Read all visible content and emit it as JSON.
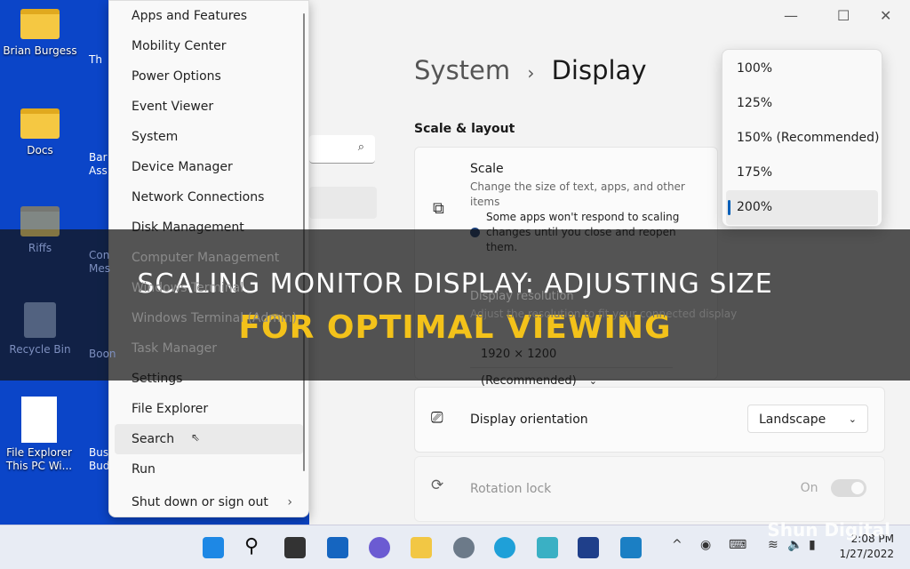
{
  "desktop": {
    "icons": [
      {
        "label": "Brian Burgess"
      },
      {
        "label": "Docs"
      },
      {
        "label": "Riffs"
      },
      {
        "label": "Recycle Bin"
      },
      {
        "label": "File Explorer This PC Wi..."
      }
    ],
    "partial_icons": [
      {
        "label": "Th"
      },
      {
        "label": "Bar Ass"
      },
      {
        "label": "Con Mes"
      },
      {
        "label": "Boon"
      },
      {
        "label": "Busin Bud"
      }
    ]
  },
  "context_menu": {
    "items": [
      "Apps and Features",
      "Mobility Center",
      "Power Options",
      "Event Viewer",
      "System",
      "Device Manager",
      "Network Connections",
      "Disk Management",
      "Computer Management",
      "Windows Terminal",
      "Windows Terminal (Admin)",
      "Task Manager",
      "Settings",
      "File Explorer",
      "Search",
      "Run",
      "Shut down or sign out"
    ],
    "hovered": "Search"
  },
  "settings": {
    "breadcrumb_parent": "System",
    "breadcrumb_sep": "›",
    "breadcrumb_current": "Display",
    "section": "Scale & layout",
    "scale": {
      "title": "Scale",
      "desc": "Change the size of text, apps, and other items",
      "note": "Some apps won't respond to scaling changes until you close and reopen them."
    },
    "resolution": {
      "title": "Display resolution",
      "desc": "Adjust the resolution to fit your connected display",
      "value": "1920 × 1200 (Recommended)"
    },
    "orientation": {
      "title": "Display orientation",
      "value": "Landscape"
    },
    "rotation": {
      "title": "Rotation lock",
      "state": "On"
    },
    "scale_options": [
      "100%",
      "125%",
      "150% (Recommended)",
      "175%",
      "200%"
    ],
    "selected_scale": "200%"
  },
  "overlay": {
    "line1": "SCALING MONITOR DISPLAY: ADJUSTING SIZE",
    "line2": "FOR OPTIMAL VIEWING"
  },
  "watermark": "Shun Digital",
  "taskbar": {
    "time": "2:08 PM",
    "date": "1/27/2022"
  },
  "colors": {
    "desktop": "#0b45c8",
    "accent": "#005fb8",
    "overlay_yellow": "#f3c21a"
  }
}
